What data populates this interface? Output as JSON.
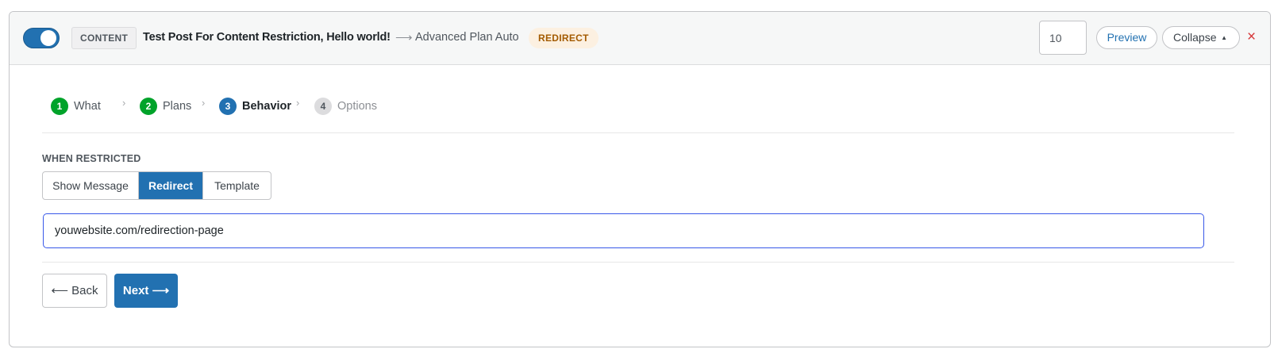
{
  "header": {
    "enabled": true,
    "content_tag": "CONTENT",
    "post_title": "Test Post For Content Restriction, Hello world!",
    "arrow": "⟶",
    "plan_name": "Advanced Plan Auto",
    "behavior_badge": "REDIRECT",
    "priority_value": "10",
    "preview_label": "Preview",
    "collapse_label": "Collapse",
    "collapse_caret": "▲",
    "close_label": "×"
  },
  "steps": [
    {
      "num": "1",
      "label": "What",
      "state": "done"
    },
    {
      "num": "2",
      "label": "Plans",
      "state": "done"
    },
    {
      "num": "3",
      "label": "Behavior",
      "state": "active"
    },
    {
      "num": "4",
      "label": "Options",
      "state": "upcoming"
    }
  ],
  "step_chevron": "›",
  "behavior": {
    "section_label": "WHEN RESTRICTED",
    "options": [
      "Show Message",
      "Redirect",
      "Template"
    ],
    "selected": "Redirect",
    "redirect_url": "youwebsite.com/redirection-page"
  },
  "nav": {
    "back_label": "⟵ Back",
    "next_label": "Next ⟶"
  },
  "colors": {
    "accent": "#2271b1",
    "done": "#00a32a",
    "danger": "#d63638",
    "badge_bg": "#fcf0e1",
    "badge_text": "#a35a00"
  }
}
